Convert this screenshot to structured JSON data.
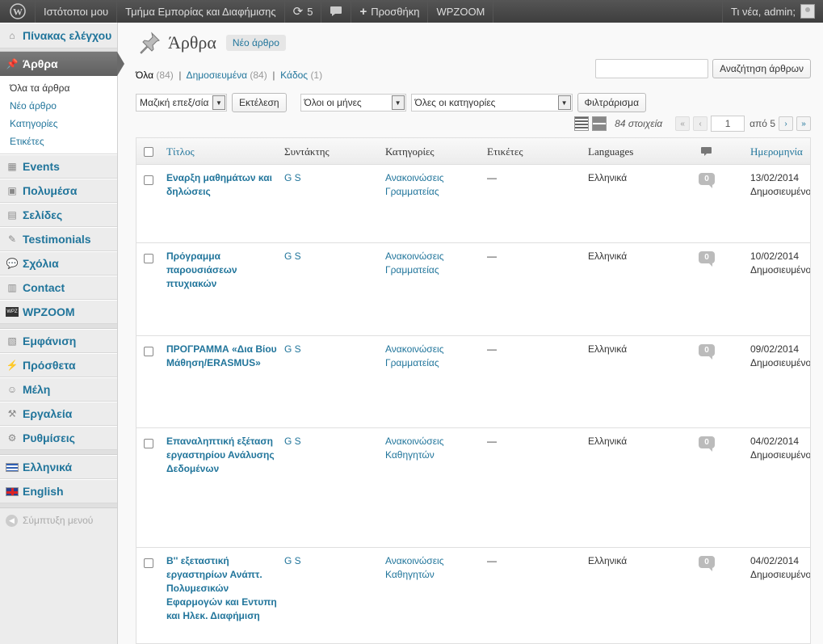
{
  "adminbar": {
    "my_sites": "Ιστότοποι μου",
    "site_name": "Τμήμα Εμπορίας και Διαφήμισης",
    "updates_count": "5",
    "add_new": "Προσθήκη",
    "wpzoom": "WPZOOM",
    "howdy": "Τι νέα, admin;"
  },
  "sidebar": {
    "dashboard": "Πίνακας ελέγχου",
    "posts": "Άρθρα",
    "submenu": [
      "Όλα τα άρθρα",
      "Νέο άρθρο",
      "Κατηγορίες",
      "Ετικέτες"
    ],
    "events": "Events",
    "media": "Πολυμέσα",
    "pages": "Σελίδες",
    "testimonials": "Testimonials",
    "comments": "Σχόλια",
    "contact": "Contact",
    "wpzoom": "WPZOOM",
    "appearance": "Εμφάνιση",
    "plugins": "Πρόσθετα",
    "users": "Μέλη",
    "tools": "Εργαλεία",
    "settings": "Ρυθμίσεις",
    "lang_gr": "Ελληνικά",
    "lang_en": "English",
    "collapse": "Σύμπτυξη μενού"
  },
  "main": {
    "title": "Άρθρα",
    "add_new": "Νέο άρθρο",
    "filters": {
      "all_label": "Όλα",
      "all_count": "(84)",
      "published_label": "Δημοσιευμένα",
      "published_count": "(84)",
      "trash_label": "Κάδος",
      "trash_count": "(1)"
    },
    "search_button": "Αναζήτηση άρθρων",
    "bulk_select": "Μαζική επεξ/σία",
    "apply_button": "Εκτέλεση",
    "months_select": "Όλοι οι μήνες",
    "categories_select": "Όλες οι κατηγορίες",
    "filter_button": "Φιλτράρισμα",
    "items_count": "84 στοιχεία",
    "current_page": "1",
    "total_pages": "από 5",
    "columns": {
      "title": "Τίτλος",
      "author": "Συντάκτης",
      "categories": "Κατηγορίες",
      "tags": "Ετικέτες",
      "languages": "Languages",
      "date": "Ημερομηνία"
    },
    "rows": [
      {
        "title": "Εναρξη μαθημάτων και δηλώσεις",
        "author": "G S",
        "categories": "Ανακοινώσεις Γραμματείας",
        "tags": "—",
        "language": "Ελληνικά",
        "comments": "0",
        "date": "13/02/2014",
        "status": "Δημοσιευμένο"
      },
      {
        "title": "Πρόγραμμα παρουσιάσεων πτυχιακών",
        "author": "G S",
        "categories": "Ανακοινώσεις Γραμματείας",
        "tags": "—",
        "language": "Ελληνικά",
        "comments": "0",
        "date": "10/02/2014",
        "status": "Δημοσιευμένο"
      },
      {
        "title": "ΠΡΟΓΡΑΜΜΑ «Δια Βίου Μάθηση/ERASMUS»",
        "author": "G S",
        "categories": "Ανακοινώσεις Γραμματείας",
        "tags": "—",
        "language": "Ελληνικά",
        "comments": "0",
        "date": "09/02/2014",
        "status": "Δημοσιευμένο"
      },
      {
        "title": "Επαναληπτική εξέταση εργαστηρίου Ανάλυσης Δεδομένων",
        "author": "G S",
        "categories": "Ανακοινώσεις Καθηγητών",
        "tags": "—",
        "language": "Ελληνικά",
        "comments": "0",
        "date": "04/02/2014",
        "status": "Δημοσιευμένο"
      },
      {
        "title": "Β'' εξεταστική εργαστηρίων Ανάπτ. Πολυμεσικών Εφαρμογών και Εντυπη και Ηλεκ. Διαφήμιση",
        "author": "G S",
        "categories": "Ανακοινώσεις Καθηγητών",
        "tags": "—",
        "language": "Ελληνικά",
        "comments": "0",
        "date": "04/02/2014",
        "status": "Δημοσιευμένο"
      }
    ]
  }
}
